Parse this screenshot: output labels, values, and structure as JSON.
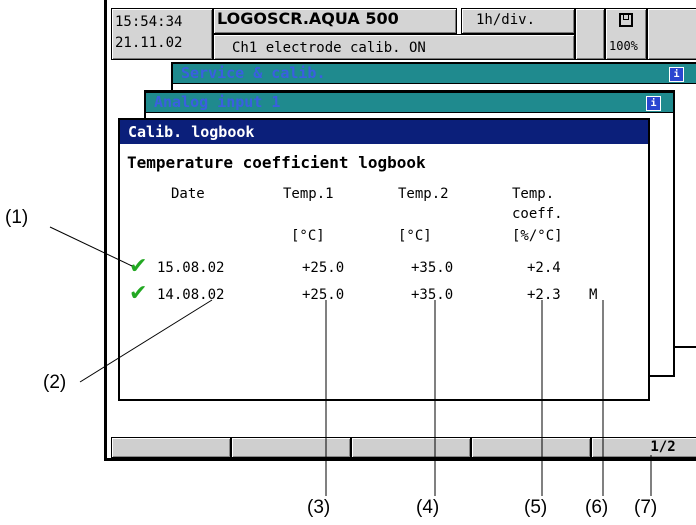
{
  "header": {
    "time": "15:54:34",
    "date": "21.11.02",
    "device_name": "LOGOSCR.AQUA 500",
    "timebase": "1h/div.",
    "status": "Ch1 electrode calib. ON",
    "memory_percent": "100%",
    "memory_icon": "memory-card-icon"
  },
  "windows": {
    "service": "Service & calib.",
    "analog": "Analog input 1",
    "logbook": "Calib. logbook",
    "info_icon": "info-icon"
  },
  "logbook": {
    "title": "Temperature coefficient logbook",
    "columns": {
      "date": "Date",
      "temp1": "Temp.1",
      "temp2": "Temp.2",
      "coeff_line1": "Temp.",
      "coeff_line2": "coeff."
    },
    "units": {
      "temp1": "[°C]",
      "temp2": "[°C]",
      "coeff": "[%/°C]"
    },
    "rows": [
      {
        "status": "check-icon",
        "date": "15.08.02",
        "temp1": "+25.0",
        "temp2": "+35.0",
        "coeff": "+2.4",
        "flag": ""
      },
      {
        "status": "check-icon",
        "date": "14.08.02",
        "temp1": "+25.0",
        "temp2": "+35.0",
        "coeff": "+2.3",
        "flag": "M"
      }
    ]
  },
  "softkeys": {
    "page": "1/2"
  },
  "callouts": [
    "(1)",
    "(2)",
    "(3)",
    "(4)",
    "(5)",
    "(6)",
    "(7)"
  ]
}
